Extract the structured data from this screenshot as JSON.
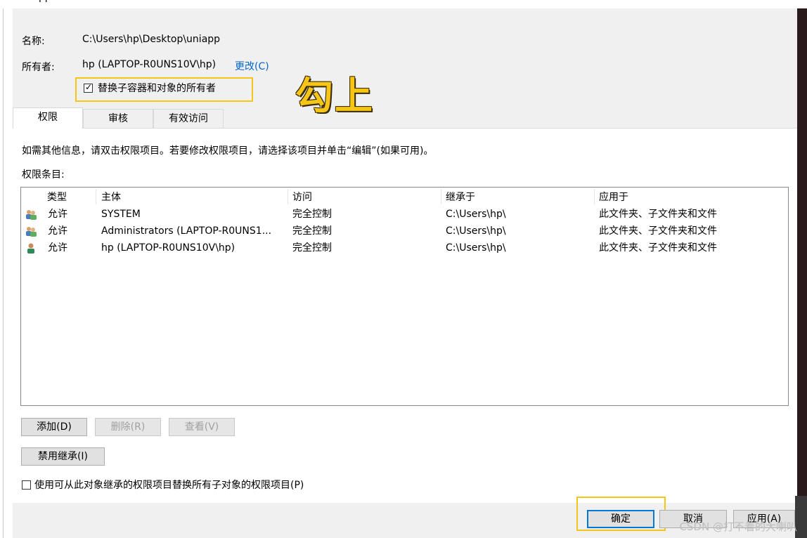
{
  "window": {
    "title_fragment": "pp"
  },
  "header": {
    "name_label": "名称:",
    "name_value": "C:\\Users\\hp\\Desktop\\uniapp",
    "owner_label": "所有者:",
    "owner_value": "hp (LAPTOP-R0UNS10V\\hp)",
    "change_link": "更改(C)",
    "replace_owner_checkbox": {
      "label": "替换子容器和对象的所有者",
      "checked": true
    }
  },
  "annotation": {
    "text": "勾上",
    "color": "#f5c518"
  },
  "tabs": [
    {
      "label": "权限",
      "active": true
    },
    {
      "label": "审核",
      "active": false
    },
    {
      "label": "有效访问",
      "active": false
    }
  ],
  "info_text": "如需其他信息，请双击权限项目。若要修改权限项目，请选择该项目并单击“编辑”(如果可用)。",
  "entries_label": "权限条目:",
  "table": {
    "columns": [
      "类型",
      "主体",
      "访问",
      "继承于",
      "应用于"
    ],
    "rows": [
      {
        "icon": "group-users-icon",
        "type": "允许",
        "principal": "SYSTEM",
        "access": "完全控制",
        "inherited": "C:\\Users\\hp\\",
        "applies": "此文件夹、子文件夹和文件"
      },
      {
        "icon": "group-users-icon",
        "type": "允许",
        "principal": "Administrators (LAPTOP-R0UNS1...",
        "access": "完全控制",
        "inherited": "C:\\Users\\hp\\",
        "applies": "此文件夹、子文件夹和文件"
      },
      {
        "icon": "single-user-icon",
        "type": "允许",
        "principal": "hp (LAPTOP-R0UNS10V\\hp)",
        "access": "完全控制",
        "inherited": "C:\\Users\\hp\\",
        "applies": "此文件夹、子文件夹和文件"
      }
    ]
  },
  "buttons": {
    "add": "添加(D)",
    "remove": "删除(R)",
    "view": "查看(V)",
    "disable_inheritance": "禁用继承(I)",
    "ok": "确定",
    "cancel": "取消",
    "apply": "应用(A)"
  },
  "replace_child_checkbox": {
    "label": "使用可从此对象继承的权限项目替换所有子对象的权限项目(P)",
    "checked": false
  },
  "watermark": "CSDN @打不着的大喇叭",
  "colors": {
    "highlight": "#f5c518",
    "link": "#0066cc",
    "accent": "#0078d7"
  }
}
